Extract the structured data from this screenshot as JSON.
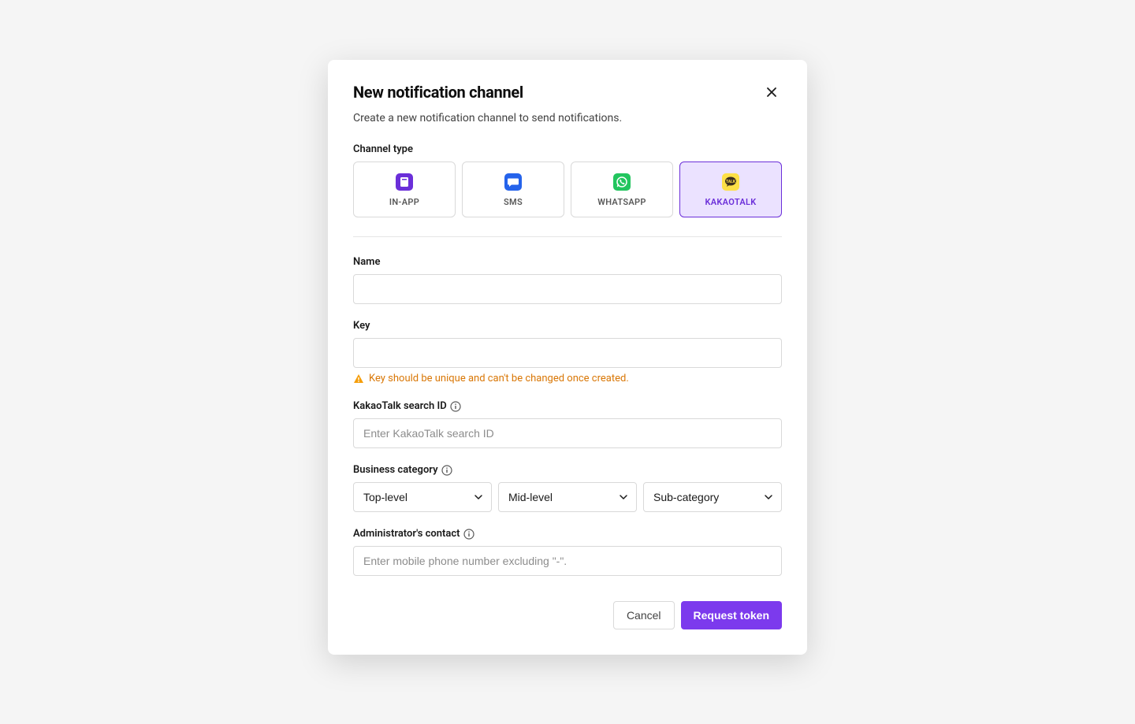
{
  "modal": {
    "title": "New notification channel",
    "description": "Create a new notification channel to send notifications.",
    "channel_type": {
      "label": "Channel type",
      "options": [
        {
          "id": "in-app",
          "label": "IN-APP"
        },
        {
          "id": "sms",
          "label": "SMS"
        },
        {
          "id": "whatsapp",
          "label": "WHATSAPP"
        },
        {
          "id": "kakaotalk",
          "label": "KAKAOTALK"
        }
      ],
      "selected": "kakaotalk"
    },
    "fields": {
      "name": {
        "label": "Name",
        "value": ""
      },
      "key": {
        "label": "Key",
        "value": "",
        "helper": "Key should be unique and can't be changed once created."
      },
      "search_id": {
        "label": "KakaoTalk search ID",
        "placeholder": "Enter KakaoTalk search ID",
        "value": ""
      },
      "business_category": {
        "label": "Business category",
        "top": "Top-level",
        "mid": "Mid-level",
        "sub": "Sub-category"
      },
      "admin_contact": {
        "label": "Administrator's contact",
        "placeholder": "Enter mobile phone number excluding \"-\".",
        "value": ""
      }
    },
    "footer": {
      "cancel": "Cancel",
      "submit": "Request token"
    }
  }
}
